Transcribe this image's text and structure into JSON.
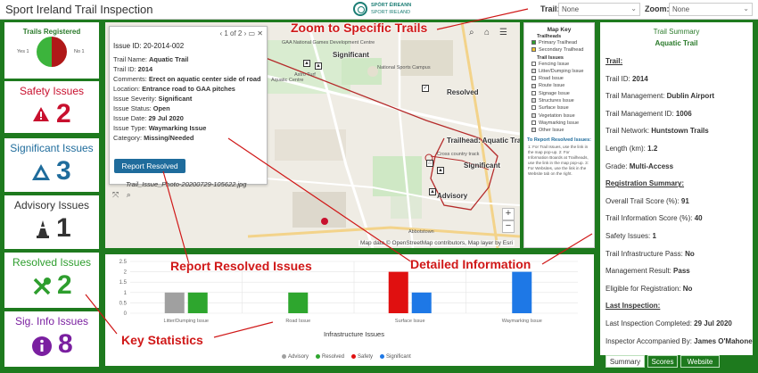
{
  "header": {
    "title": "Sport Ireland Trail Inspection",
    "brand_line1": "SPÓRT ÉIREANN",
    "brand_line2": "SPORT IRELAND",
    "trail_label": "Trail:",
    "trail_value": "None",
    "zoom_label": "Zoom:",
    "zoom_value": "None"
  },
  "cards": {
    "registered": {
      "title": "Trails Registered",
      "yes_label": "Yes 1",
      "no_label": "No 1"
    },
    "safety": {
      "title": "Safety Issues",
      "value": "2",
      "color": "#c8102e"
    },
    "significant": {
      "title": "Significant Issues",
      "value": "3",
      "color": "#1f6c9c"
    },
    "advisory": {
      "title": "Advisory Issues",
      "value": "1",
      "color": "#333333"
    },
    "resolved": {
      "title": "Resolved Issues",
      "value": "2",
      "color": "#2e9e2e"
    },
    "info": {
      "title": "Sig. Info Issues",
      "value": "8",
      "color": "#7a1fa0"
    }
  },
  "popup": {
    "title": "Issue ID: 20-2014-002",
    "nav": "1 of 2",
    "rows": [
      {
        "label": "Trail Name: ",
        "value": "Aquatic Trail"
      },
      {
        "label": "Trail ID: ",
        "value": "2014"
      },
      {
        "label": "Comments: ",
        "value": "Erect on aquatic center side of road"
      },
      {
        "label": "Location: ",
        "value": "Entrance road to GAA pitches"
      },
      {
        "label": "Issue Severity: ",
        "value": "Significant"
      },
      {
        "label": "Issue Status: ",
        "value": "Open"
      },
      {
        "label": "Issue Date: ",
        "value": "29 Jul 2020"
      },
      {
        "label": "Issue Type: ",
        "value": "Waymarking Issue"
      },
      {
        "label": "Category: ",
        "value": "Missing/Needed"
      }
    ],
    "report_button": "Report Resolved",
    "photo": "Trail_Issue_Photo-20200729-105622.jpg"
  },
  "map": {
    "labels": [
      "Significant",
      "Resolved",
      "Trailhead: Aquatic Trail",
      "Significant",
      "Advisory"
    ],
    "places": [
      "GAA National Games Development Centre",
      "Astro Turf",
      "Aquatic Centre",
      "National Sports Campus",
      "Abbotstown",
      "Cross country track"
    ],
    "attribution": "Map data © OpenStreetMap contributors, Map layer by Esri",
    "zoom_in": "+",
    "zoom_out": "−"
  },
  "mapkey": {
    "title": "Map Key",
    "trailheads_heading": "Trailheads",
    "trailheads": [
      "Primary Trailhead",
      "Secondary Trailhead"
    ],
    "issues_heading": "Trail Issues",
    "issues": [
      "Fencing Issue",
      "Litter/Dumping Issue",
      "Road Issue",
      "Route Issue",
      "Signage Issue",
      "Structures Issue",
      "Surface Issue",
      "Vegetation Issue",
      "Waymarking Issue",
      "Other Issue"
    ],
    "report_heading": "To Report Resolved Issues:",
    "report_text": "1: For Trail Issues, use the link in the map pop-up. 2: For Information Boards at Trailheads, use the link in the map pop-up. 3: For Websites, use the link in the Website tab on the right."
  },
  "chart_data": {
    "type": "bar",
    "title": "",
    "xlabel": "Infrastructure Issues",
    "ylabel": "",
    "ylim": [
      0,
      2.5
    ],
    "yticks": [
      "0",
      "0.5",
      "1",
      "1.5",
      "2",
      "2.5"
    ],
    "categories": [
      "Litter/Dumping Issue",
      "Road Issue",
      "Surface Issue",
      "Waymarking Issue"
    ],
    "series": [
      {
        "name": "Advisory",
        "color": "#a0a0a0",
        "values": [
          1,
          0,
          0,
          0
        ]
      },
      {
        "name": "Resolved",
        "color": "#2ea62e",
        "values": [
          1,
          1,
          0,
          0
        ]
      },
      {
        "name": "Safety",
        "color": "#e01010",
        "values": [
          0,
          0,
          2,
          0
        ]
      },
      {
        "name": "Significant",
        "color": "#1e78e6",
        "values": [
          0,
          0,
          1,
          2
        ]
      }
    ],
    "grid": true,
    "legend": "bottom"
  },
  "summary": {
    "heading": "Trail Summary",
    "trail_name": "Aquatic Trail",
    "lines": [
      {
        "type": "section",
        "label": "Trail:"
      },
      {
        "label": "Trail ID: ",
        "value": "2014"
      },
      {
        "label": "Trail Management: ",
        "value": "Dublin Airport"
      },
      {
        "label": "Trail Management ID: ",
        "value": "1006"
      },
      {
        "label": "Trail Network: ",
        "value": "Huntstown Trails"
      },
      {
        "label": "Length (km): ",
        "value": "1.2"
      },
      {
        "label": "Grade: ",
        "value": "Multi-Access"
      },
      {
        "type": "section",
        "label": "Registration Summary:"
      },
      {
        "label": "Overall Trail Score (%): ",
        "value": "91"
      },
      {
        "label": "Trail Information Score (%): ",
        "value": "40"
      },
      {
        "label": "Safety Issues: ",
        "value": "1"
      },
      {
        "label": "Trail Infrastructure Pass: ",
        "value": "No"
      },
      {
        "label": "Management Result: ",
        "value": "Pass"
      },
      {
        "label": "Eligible for Registration: ",
        "value": "No"
      },
      {
        "type": "section",
        "label": "Last Inspection:"
      },
      {
        "label": "Last Inspection Completed: ",
        "value": "29 Jul 2020"
      },
      {
        "label": "Inspector Accompanied By: ",
        "value": "James O'Mahoney"
      }
    ]
  },
  "tabs": [
    "Summary",
    "Scores",
    "Website"
  ],
  "annotations": {
    "zoom": "Zoom to Specific Trails",
    "report": "Report Resolved Issues",
    "detailed": "Detailed Information",
    "key_stats": "Key Statistics"
  }
}
